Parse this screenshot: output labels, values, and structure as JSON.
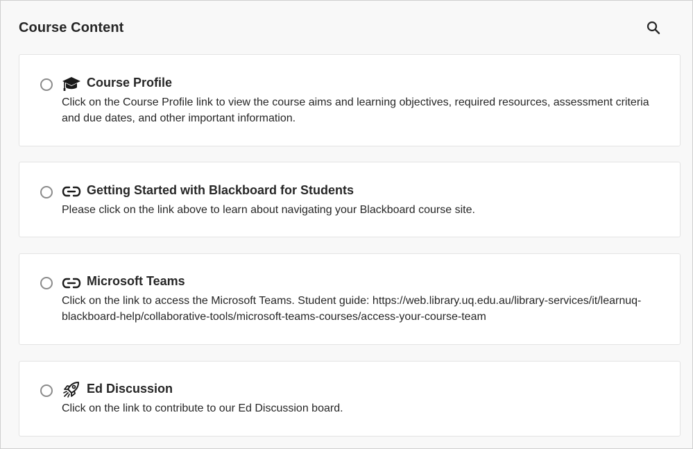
{
  "header": {
    "title": "Course Content"
  },
  "items": [
    {
      "title": "Course Profile",
      "icon": "graduation-cap-icon",
      "description": "Click on the Course Profile link to view the course aims and learning objectives, required resources, assessment criteria and due dates, and other important information."
    },
    {
      "title": "Getting Started with Blackboard for Students",
      "icon": "link-icon",
      "description": "Please click on the link above to learn about navigating your Blackboard course site."
    },
    {
      "title": "Microsoft Teams",
      "icon": "link-icon",
      "description": "Click on the link to access the Microsoft Teams. Student guide: https://web.library.uq.edu.au/library-services/it/learnuq-blackboard-help/collaborative-tools/microsoft-teams-courses/access-your-course-team"
    },
    {
      "title": "Ed Discussion",
      "icon": "rocket-icon",
      "description": "Click on the link to contribute to our Ed Discussion board."
    }
  ]
}
